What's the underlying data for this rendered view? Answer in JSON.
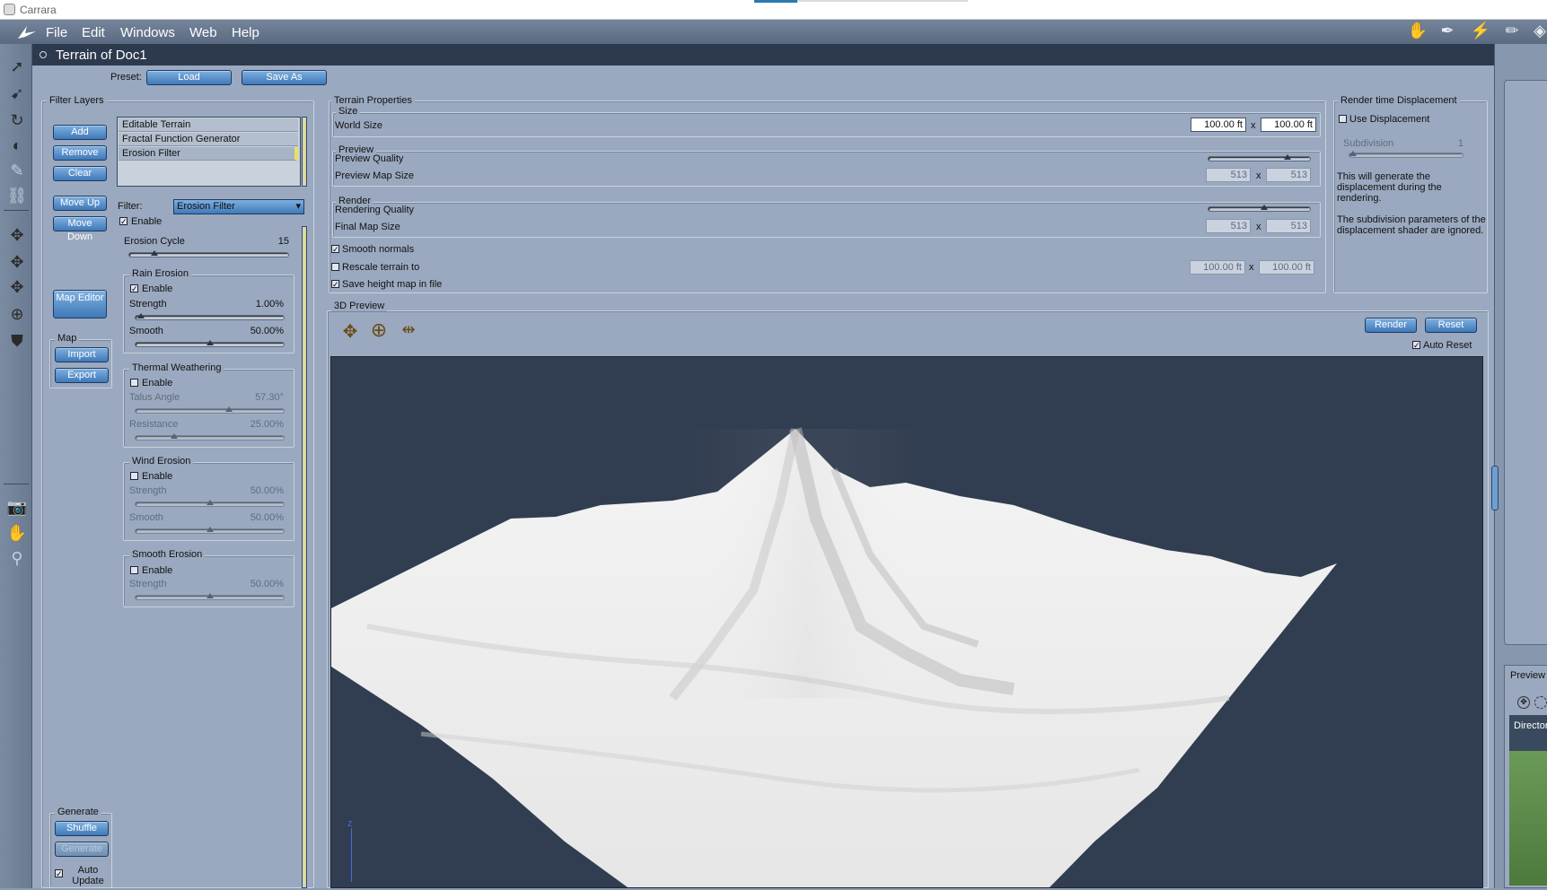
{
  "app": {
    "title": "Carrara"
  },
  "menu": {
    "items": [
      "File",
      "Edit",
      "Windows",
      "Web",
      "Help"
    ]
  },
  "document": {
    "title": "Terrain of Doc1"
  },
  "preset": {
    "label": "Preset:",
    "load": "Load",
    "save_as": "Save As"
  },
  "filter_layers": {
    "title": "Filter Layers",
    "buttons": {
      "add": "Add",
      "remove": "Remove",
      "clear": "Clear",
      "move_up": "Move Up",
      "move_down": "Move Down",
      "map_editor": "Map Editor"
    },
    "layers": [
      "Editable Terrain",
      "Fractal Function Generator",
      "Erosion Filter"
    ],
    "selected_layer": "Erosion Filter",
    "map": {
      "title": "Map",
      "import": "Import",
      "export": "Export"
    },
    "generate": {
      "title": "Generate",
      "shuffle": "Shuffle",
      "generate": "Generate",
      "auto_update": "Auto Update",
      "auto_update_checked": true
    }
  },
  "filter": {
    "label": "Filter:",
    "value": "Erosion Filter",
    "enable": "Enable",
    "erosion_cycle": {
      "label": "Erosion Cycle",
      "value": "15",
      "level": 0.14
    },
    "rain_erosion": {
      "title": "Rain Erosion",
      "enable": "Enable",
      "enabled": true,
      "strength": {
        "label": "Strength",
        "value": "1.00%",
        "level": 0.01
      },
      "smooth": {
        "label": "Smooth",
        "value": "50.00%",
        "level": 0.5
      }
    },
    "thermal_weathering": {
      "title": "Thermal Weathering",
      "enable": "Enable",
      "enabled": false,
      "talus_angle": {
        "label": "Talus Angle",
        "value": "57.30°",
        "level": 0.64
      },
      "resistance": {
        "label": "Resistance",
        "value": "25.00%",
        "level": 0.25
      }
    },
    "wind_erosion": {
      "title": "Wind Erosion",
      "enable": "Enable",
      "enabled": false,
      "strength": {
        "label": "Strength",
        "value": "50.00%",
        "level": 0.5
      },
      "smooth": {
        "label": "Smooth",
        "value": "50.00%",
        "level": 0.5
      }
    },
    "smooth_erosion": {
      "title": "Smooth Erosion",
      "enable": "Enable",
      "enabled": false,
      "strength": {
        "label": "Strength",
        "value": "50.00%",
        "level": 0.5
      }
    }
  },
  "terrain_properties": {
    "title": "Terrain Properties",
    "size": {
      "title": "Size",
      "world_size_label": "World Size",
      "w": "100.00 ft",
      "h": "100.00 ft",
      "x": "x"
    },
    "preview": {
      "title": "Preview",
      "quality_label": "Preview Quality",
      "quality_level": 0.8,
      "map_size_label": "Preview Map Size",
      "w": "513",
      "h": "513",
      "x": "x"
    },
    "render": {
      "title": "Render",
      "quality_label": "Rendering Quality",
      "quality_level": 0.55,
      "map_size_label": "Final Map Size",
      "w": "513",
      "h": "513",
      "x": "x"
    },
    "smooth_normals": "Smooth normals",
    "rescale": {
      "label": "Rescale terrain to",
      "w": "100.00 ft",
      "h": "100.00 ft",
      "x": "x"
    },
    "save_height": "Save height map in file"
  },
  "displacement": {
    "title": "Render time Displacement",
    "use": "Use Displacement",
    "subdivision": {
      "label": "Subdivision",
      "value": "1"
    },
    "note1": "This will generate the displacement during the rendering.",
    "note2": "The subdivision parameters of the displacement shader are ignored."
  },
  "preview3d": {
    "title": "3D Preview",
    "render": "Render",
    "reset": "Reset",
    "auto_reset": "Auto Reset",
    "axis": "z"
  },
  "right_panel": {
    "preview": "Preview",
    "director": "Director"
  }
}
